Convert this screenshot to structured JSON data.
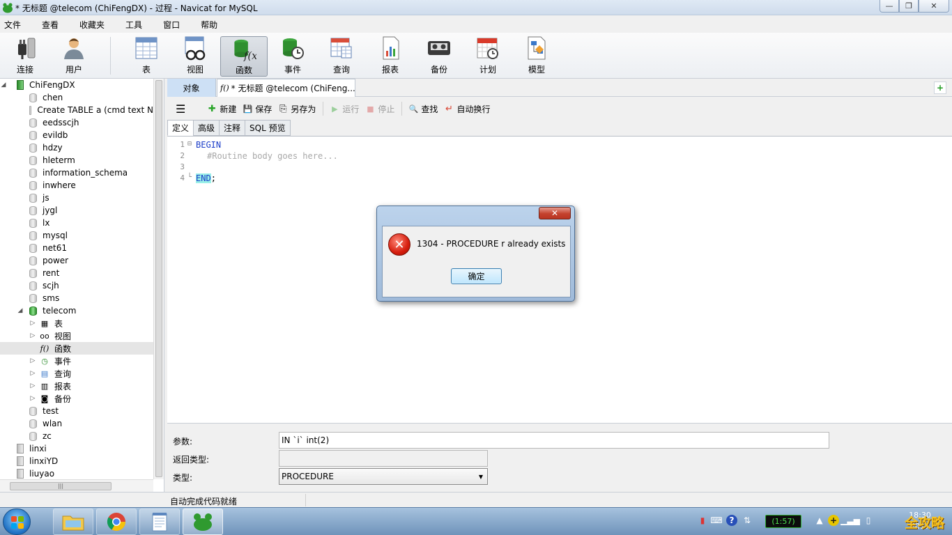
{
  "window": {
    "title": "* 无标题 @telecom (ChiFengDX) - 过程 - Navicat for MySQL",
    "min_glyph": "—",
    "max_glyph": "❐",
    "close_glyph": "✕"
  },
  "menu": [
    "文件",
    "查看",
    "收藏夹",
    "工具",
    "窗口",
    "帮助"
  ],
  "toolbar": [
    {
      "label": "连接",
      "icon": "plug-icon"
    },
    {
      "label": "用户",
      "icon": "user-icon"
    },
    {
      "label": "表",
      "icon": "table-icon"
    },
    {
      "label": "视图",
      "icon": "view-glasses-icon"
    },
    {
      "label": "函数",
      "icon": "function-icon",
      "active": true
    },
    {
      "label": "事件",
      "icon": "event-clock-icon"
    },
    {
      "label": "查询",
      "icon": "query-icon"
    },
    {
      "label": "报表",
      "icon": "report-icon"
    },
    {
      "label": "备份",
      "icon": "backup-tape-icon"
    },
    {
      "label": "计划",
      "icon": "schedule-calendar-icon"
    },
    {
      "label": "模型",
      "icon": "model-icon"
    }
  ],
  "tree": {
    "connection": "ChiFengDX",
    "databases_before": [
      "chen",
      "Create TABLE a (cmd text N",
      "eedsscjh",
      "evildb",
      "hdzy",
      "hleterm",
      "information_schema",
      "inwhere",
      "js",
      "jygl",
      "lx",
      "mysql",
      "net61",
      "power",
      "rent",
      "scjh",
      "sms"
    ],
    "open_db": "telecom",
    "open_db_children": [
      {
        "label": "表",
        "icon": "table-icon",
        "glyph": "▦"
      },
      {
        "label": "视图",
        "icon": "view-glasses-icon",
        "glyph": "oo"
      },
      {
        "label": "函数",
        "icon": "function-icon",
        "glyph": "f()",
        "selected": true
      },
      {
        "label": "事件",
        "icon": "event-clock-icon",
        "glyph": "◷"
      },
      {
        "label": "查询",
        "icon": "query-icon",
        "glyph": "▤"
      },
      {
        "label": "报表",
        "icon": "report-icon",
        "glyph": "▥"
      },
      {
        "label": "备份",
        "icon": "backup-tape-icon",
        "glyph": "◙"
      }
    ],
    "databases_after": [
      "test",
      "wlan",
      "zc"
    ],
    "other_connections": [
      "linxi",
      "linxiYD",
      "liuyao"
    ],
    "hscroll_grip": "|||"
  },
  "tabs": {
    "objects": "对象",
    "editor_icon": "f()",
    "editor_title": "* 无标题 @telecom (ChiFeng...",
    "add_glyph": "+"
  },
  "editbar": {
    "menu_glyph": "☰",
    "new": "新建",
    "save": "保存",
    "save_as": "另存为",
    "run": "运行",
    "stop": "停止",
    "find": "查找",
    "wrap": "自动换行",
    "new_glyph": "✚",
    "save_glyph": "💾",
    "save_as_glyph": "⎘",
    "run_glyph": "▶",
    "stop_glyph": "■",
    "find_glyph": "🔍",
    "wrap_glyph": "↵"
  },
  "subtabs": [
    "定义",
    "高级",
    "注释",
    "SQL 预览"
  ],
  "code": {
    "line_numbers": [
      "1",
      "2",
      "3",
      "4"
    ],
    "fold_open": "⊟",
    "fold_close": "└",
    "begin": "BEGIN",
    "comment": "#Routine body goes here...",
    "end": "END",
    "end_suffix": ";"
  },
  "params": {
    "params_label": "参数:",
    "params_value": "IN `i` int(2)",
    "return_label": "返回类型:",
    "return_value": "",
    "type_label": "类型:",
    "type_value": "PROCEDURE",
    "caret": "▼"
  },
  "status": "自动完成代码就绪",
  "dialog": {
    "message": "1304 - PROCEDURE r already exists",
    "ok": "确定",
    "close": "✕",
    "error_glyph": "✕"
  },
  "taskbar": {
    "battery": "(1:57)",
    "clock_time": "18:30",
    "clock_date": "2017"
  },
  "watermark": "全攻略",
  "colors": {
    "accent": "#cde0f5",
    "keyword": "#1a3cc8",
    "db_active": "#2c9c2c"
  }
}
